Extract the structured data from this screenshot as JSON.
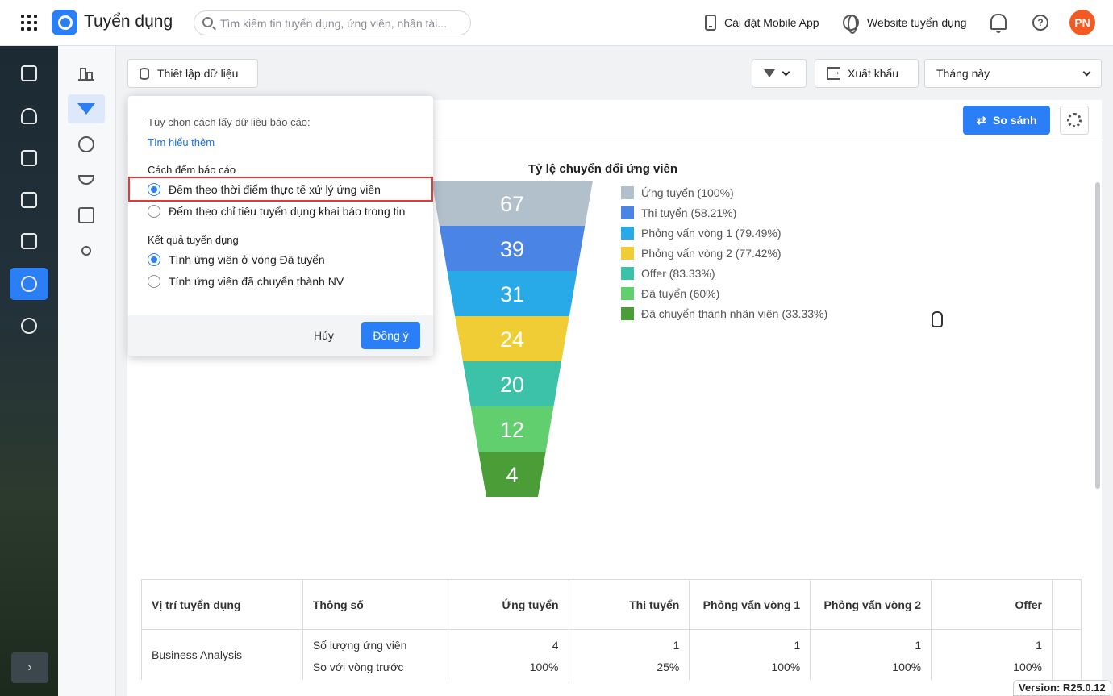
{
  "topbar": {
    "app_title": "Tuyển dụng",
    "search_placeholder": "Tìm kiếm tin tuyển dụng, ứng viên, nhân tài...",
    "mobile_app_label": "Cài đặt Mobile App",
    "website_label": "Website tuyển dụng",
    "avatar_initials": "PN"
  },
  "toolbar": {
    "data_setup_label": "Thiết lập dữ liệu",
    "export_label": "Xuất khẩu",
    "period_value": "Tháng này",
    "compare_label": "So sánh"
  },
  "popup": {
    "hint": "Tùy chọn cách lấy dữ liệu báo cáo:",
    "learn_more": "Tìm hiểu thêm",
    "count_section": "Cách đếm báo cáo",
    "count_option_1": "Đếm theo thời điểm thực tế xử lý ứng viên",
    "count_option_2": "Đếm theo chỉ tiêu tuyển dụng khai báo trong tin",
    "result_section": "Kết quả tuyển dụng",
    "result_option_1": "Tính ứng viên ở vòng Đã tuyển",
    "result_option_2": "Tính ứng viên đã chuyển thành NV",
    "cancel_label": "Hủy",
    "ok_label": "Đồng ý"
  },
  "chart_data": {
    "type": "funnel",
    "title": "Tỷ lệ chuyển đổi ứng viên",
    "categories": [
      "Ứng tuyển",
      "Thi tuyển",
      "Phỏng vấn vòng 1",
      "Phỏng vấn vòng 2",
      "Offer",
      "Đã tuyển",
      "Đã chuyển thành nhân viên"
    ],
    "values": [
      67,
      39,
      31,
      24,
      20,
      12,
      4
    ],
    "legend": [
      "Ứng tuyển (100%)",
      "Thi tuyển (58.21%)",
      "Phỏng vấn vòng 1 (79.49%)",
      "Phỏng vấn vòng 2 (77.42%)",
      "Offer (83.33%)",
      "Đã tuyển (60%)",
      "Đã chuyển thành nhân viên (33.33%)"
    ],
    "colors": [
      "#b2c0cc",
      "#4a84e4",
      "#28a9e8",
      "#f0cd35",
      "#3cc2a8",
      "#62cf6e",
      "#4b9e37"
    ],
    "legend_position": "right"
  },
  "table": {
    "headers": [
      "Vị trí tuyển dụng",
      "Thông số",
      "Ứng tuyển",
      "Thi tuyển",
      "Phỏng vấn vòng 1",
      "Phỏng vấn vòng 2",
      "Offer"
    ],
    "position": "Business Analysis",
    "metric_1": "Số lượng ứng viên",
    "metric_2": "So với vòng trước",
    "row_1": [
      "4",
      "1",
      "1",
      "1",
      "1"
    ],
    "row_2": [
      "100%",
      "25%",
      "100%",
      "100%",
      "100%"
    ]
  },
  "version": "Version: R25.0.12"
}
